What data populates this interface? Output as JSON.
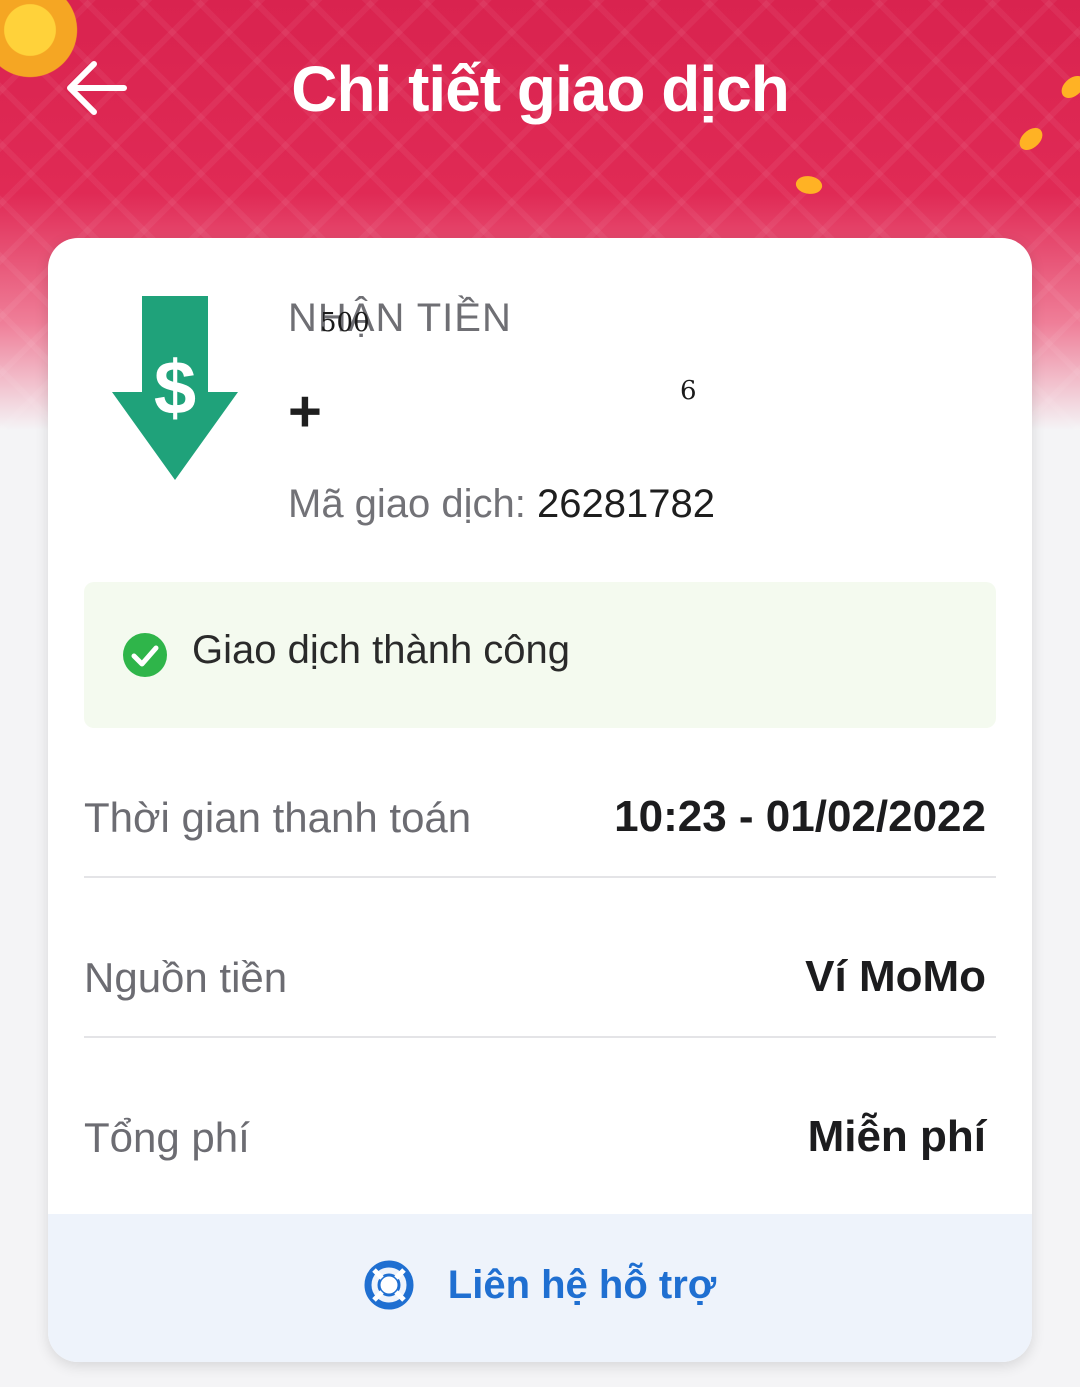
{
  "header": {
    "title": "Chi tiết giao dịch",
    "back_icon": "back-arrow-icon"
  },
  "transaction": {
    "type_label": "NHẬN TIỀN",
    "amount_prefix": "+",
    "overlay_amount_left": "500",
    "overlay_amount_right": "6",
    "id_label": "Mã giao dịch:",
    "id_value": "26281782",
    "status_text": "Giao dịch thành công",
    "status_color": "#2fb54a",
    "icon_color": "#1fa27a"
  },
  "details": [
    {
      "label": "Thời gian thanh toán",
      "value": "10:23 - 01/02/2022"
    },
    {
      "label": "Nguồn tiền",
      "value": "Ví MoMo"
    },
    {
      "label": "Tổng phí",
      "value": "Miễn phí"
    }
  ],
  "support": {
    "label": "Liên hệ hỗ trợ",
    "icon": "lifebuoy-icon",
    "color": "#1f6fd1"
  },
  "theme": {
    "header_color": "#d9234f"
  }
}
